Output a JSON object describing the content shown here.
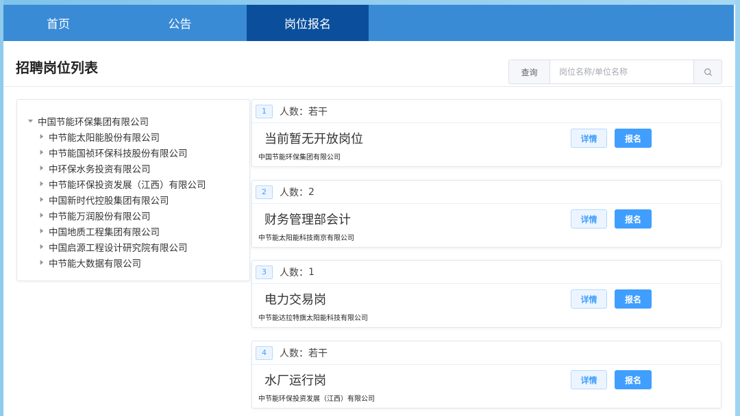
{
  "nav": {
    "items": [
      {
        "label": "首页",
        "active": false
      },
      {
        "label": "公告",
        "active": false
      },
      {
        "label": "岗位报名",
        "active": true
      }
    ],
    "color": "#3a8bd6",
    "active_color": "#0b4f9c"
  },
  "page": {
    "title": "招聘岗位列表"
  },
  "search": {
    "label": "查询",
    "placeholder": "岗位名称/单位名称",
    "value": "",
    "button_icon": "search-icon"
  },
  "tree": {
    "root": {
      "label": "中国节能环保集团有限公司",
      "expanded": true,
      "icon": "caret-down-icon"
    },
    "children": [
      {
        "label": "中节能太阳能股份有限公司"
      },
      {
        "label": "中节能国祯环保科技股份有限公司"
      },
      {
        "label": "中环保水务投资有限公司"
      },
      {
        "label": "中节能环保投资发展（江西）有限公司"
      },
      {
        "label": "中国新时代控股集团有限公司"
      },
      {
        "label": "中节能万润股份有限公司"
      },
      {
        "label": "中国地质工程集团有限公司"
      },
      {
        "label": "中国启源工程设计研究院有限公司"
      },
      {
        "label": "中节能大数据有限公司"
      }
    ],
    "child_icon": "caret-right-icon"
  },
  "jobs": [
    {
      "index": "1",
      "count_label": "人数：",
      "count": "若干",
      "title": "当前暂无开放岗位",
      "company": "中国节能环保集团有限公司",
      "detail_label": "详情",
      "apply_label": "报名"
    },
    {
      "index": "2",
      "count_label": "人数：",
      "count": "2",
      "title": "财务管理部会计",
      "company": "中节能太阳能科技南京有限公司",
      "detail_label": "详情",
      "apply_label": "报名"
    },
    {
      "index": "3",
      "count_label": "人数：",
      "count": "1",
      "title": "电力交易岗",
      "company": "中节能达拉特旗太阳能科技有限公司",
      "detail_label": "详情",
      "apply_label": "报名"
    },
    {
      "index": "4",
      "count_label": "人数：",
      "count": "若干",
      "title": "水厂运行岗",
      "company": "中节能环保投资发展（江西）有限公司",
      "detail_label": "详情",
      "apply_label": "报名"
    }
  ],
  "colors": {
    "primary": "#409eff",
    "primary_light": "#ecf5ff"
  }
}
